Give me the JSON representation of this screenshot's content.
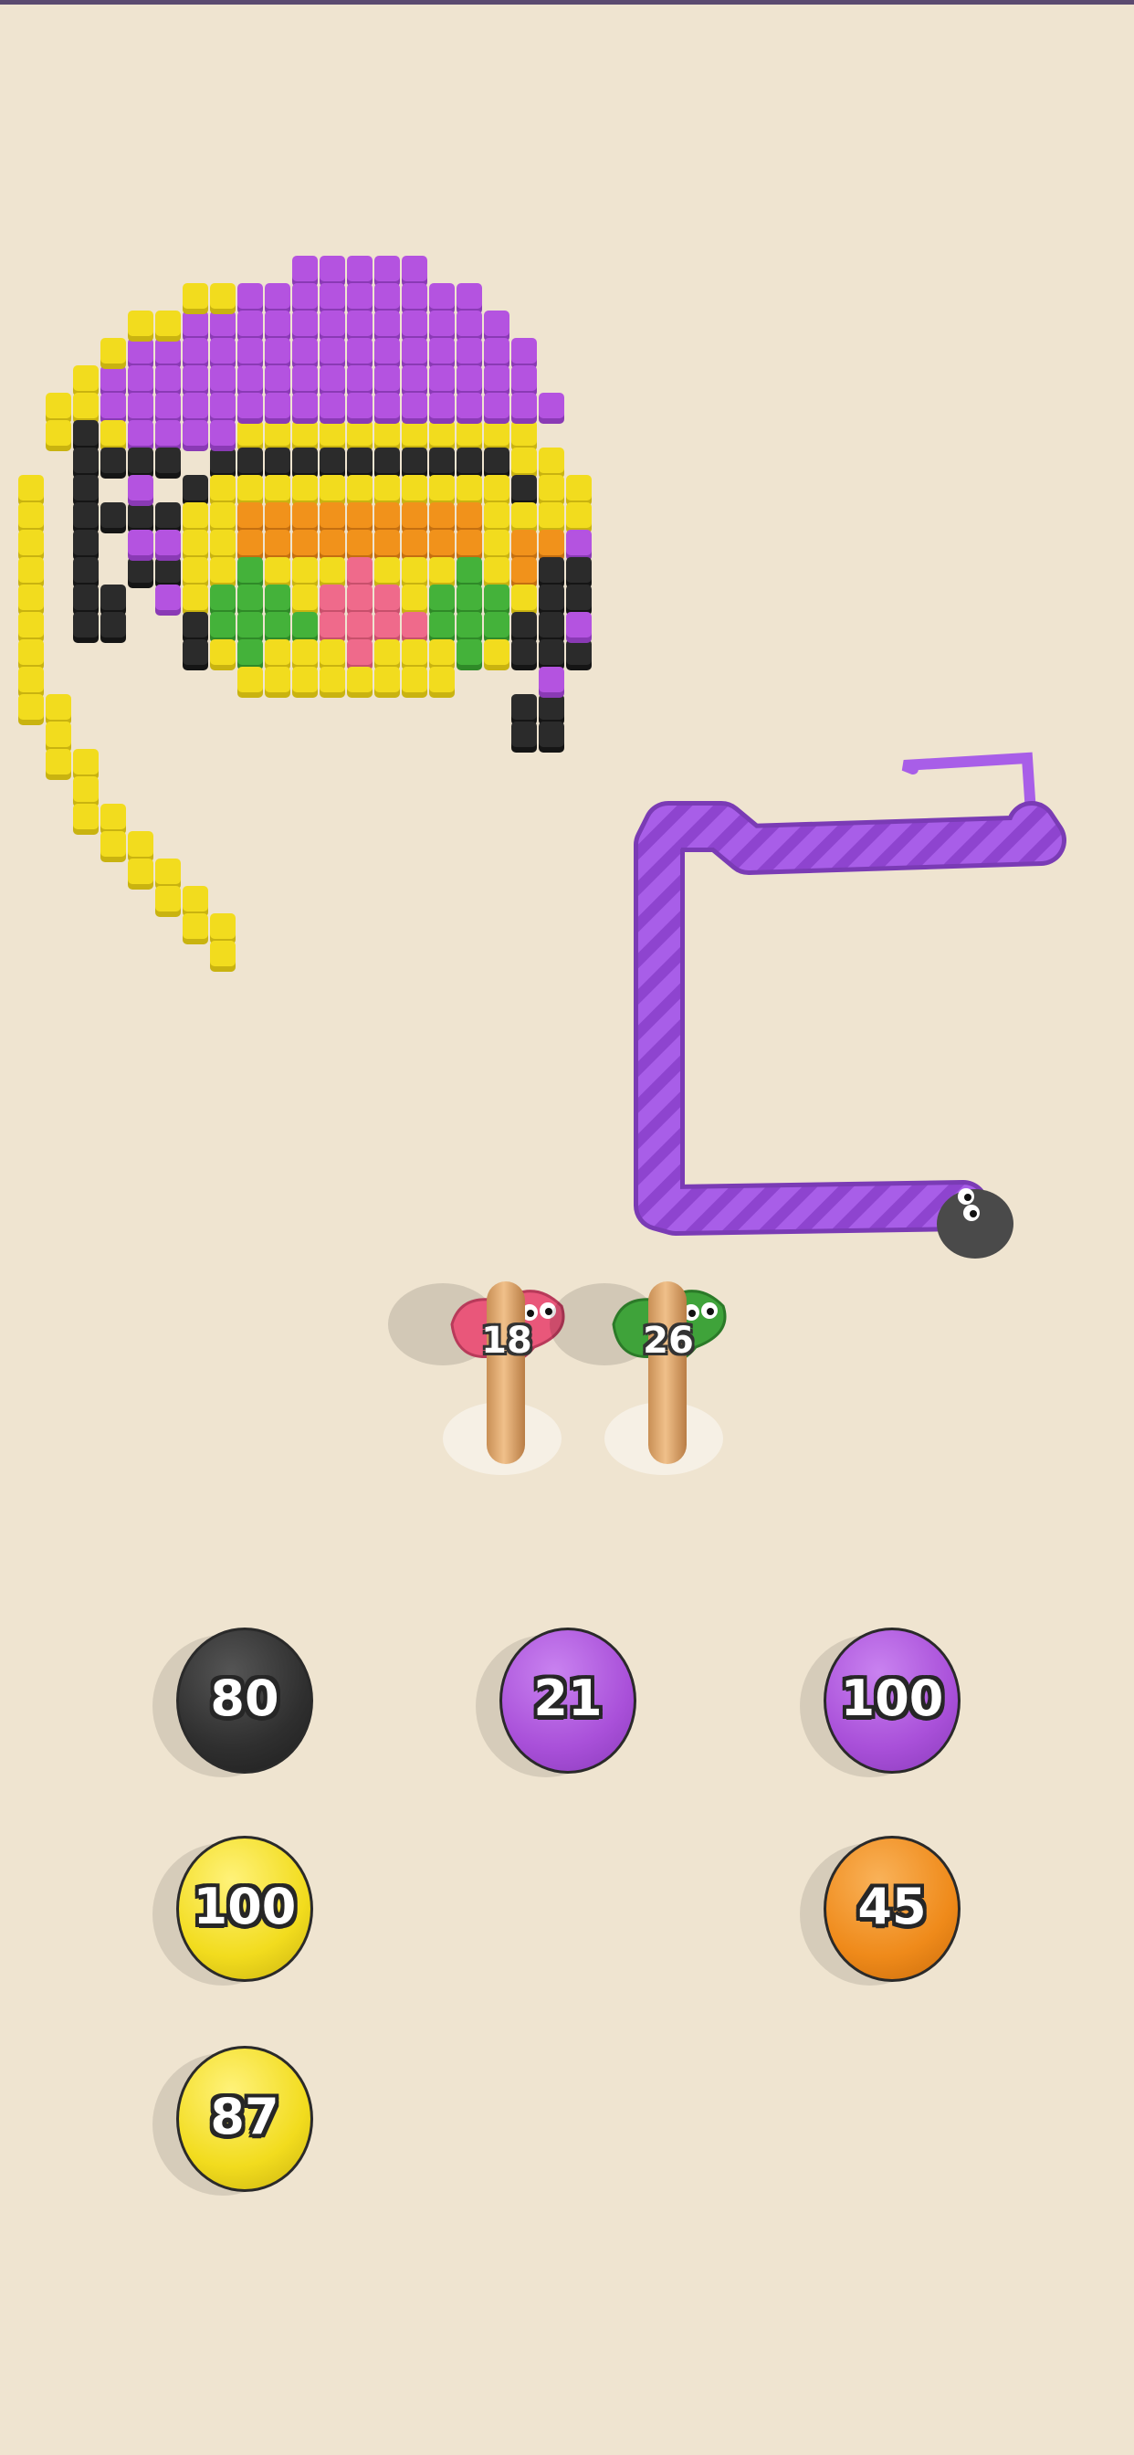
{
  "game": {
    "colors": {
      "yellow": "#f2dc1e",
      "purple": "#b453e0",
      "black": "#2b2b2b",
      "orange": "#f1921b",
      "green": "#44b23a",
      "pink": "#ef6a8b",
      "background": "#efe4d0",
      "worm_purple": "#a85ee8"
    },
    "sticks": [
      {
        "count": "18",
        "color": "#e9577a",
        "icon": "pink-worm-icon"
      },
      {
        "count": "26",
        "color": "#3fa33a",
        "icon": "green-worm-icon"
      }
    ],
    "balls": [
      {
        "value": "80",
        "color": "#2f2f2f"
      },
      {
        "value": "21",
        "color": "#a950d9"
      },
      {
        "value": "100",
        "color": "#a950d9"
      },
      {
        "value": "100",
        "color": "#f2dc1e"
      },
      {
        "value": "45",
        "color": "#ef8a1a"
      },
      {
        "value": "87",
        "color": "#f2dc1e"
      }
    ]
  }
}
